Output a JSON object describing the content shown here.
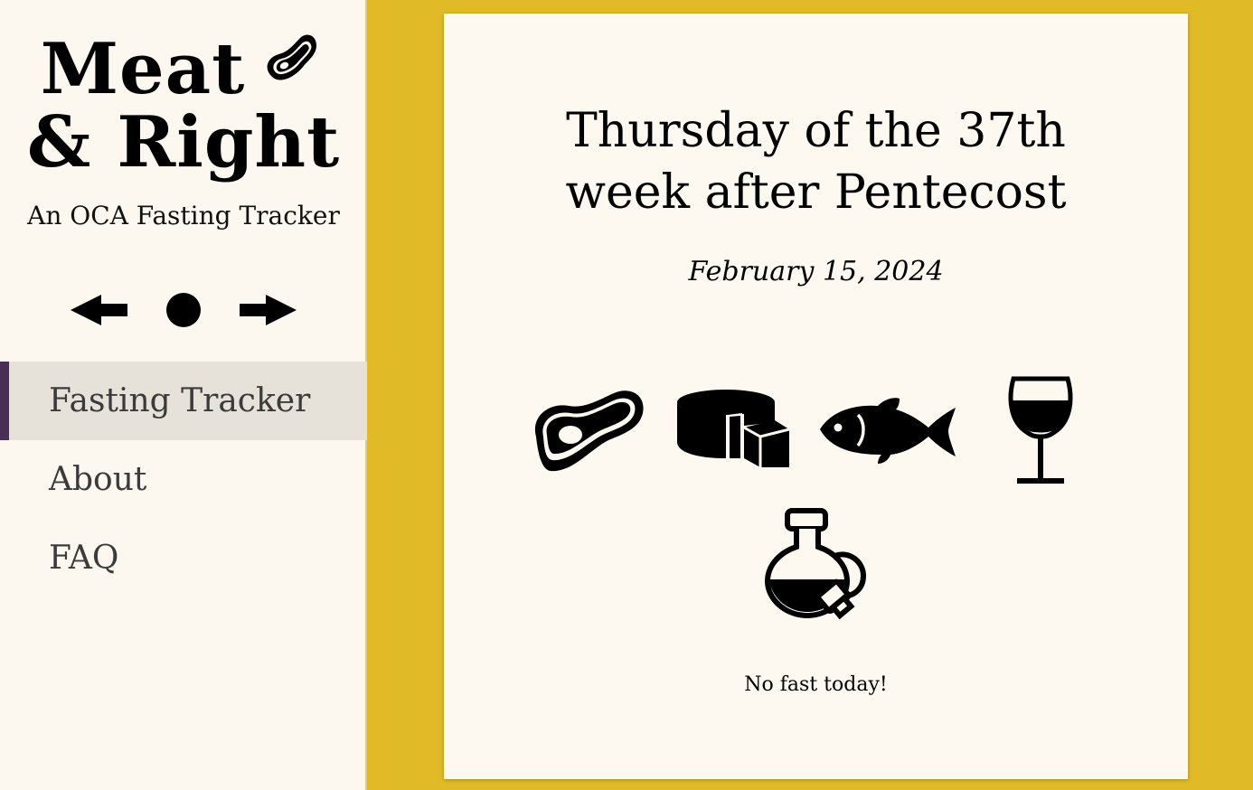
{
  "app": {
    "logo_line1": "Meat",
    "logo_line2": "& Right",
    "tagline": "An OCA Fasting Tracker",
    "logo_icon": "steak-icon"
  },
  "nav_controls": {
    "prev_icon": "arrow-left-icon",
    "today_icon": "circle-icon",
    "next_icon": "arrow-right-icon"
  },
  "menu": {
    "items": [
      {
        "label": "Fasting Tracker",
        "active": true
      },
      {
        "label": "About",
        "active": false
      },
      {
        "label": "FAQ",
        "active": false
      }
    ]
  },
  "day": {
    "title_line1": "Thursday of the 37th",
    "title_line2": "week after Pentecost",
    "date": "February 15, 2024",
    "foods": [
      {
        "icon": "meat-icon"
      },
      {
        "icon": "cheese-icon"
      },
      {
        "icon": "fish-icon"
      },
      {
        "icon": "wine-icon"
      },
      {
        "icon": "oil-icon"
      }
    ],
    "status": "No fast today!"
  },
  "colors": {
    "background": "#e0ba27",
    "sidebar": "#fcf8f0",
    "card": "#fdf9f1",
    "active_menu": "#e6e2da",
    "active_marker": "#4b2e55"
  }
}
